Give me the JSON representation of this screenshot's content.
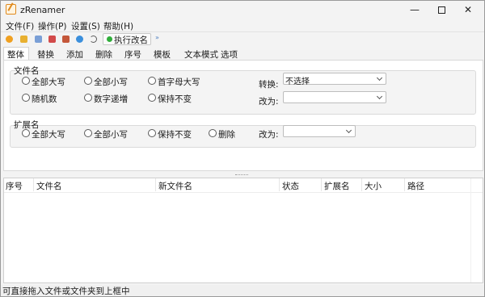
{
  "app": {
    "title": "zRenamer"
  },
  "window_controls": {
    "minimize": "—",
    "close": "✕"
  },
  "menu": [
    {
      "label": "文件(F)"
    },
    {
      "label": "操作(P)"
    },
    {
      "label": "设置(S)"
    },
    {
      "label": "帮助(H)"
    }
  ],
  "toolbar": {
    "icons": [
      {
        "name": "gear-icon",
        "color": "#f0a020"
      },
      {
        "name": "folder-icon",
        "color": "#e8b030"
      },
      {
        "name": "page-icon",
        "color": "#7a9fd6"
      },
      {
        "name": "book-icon",
        "color": "#d24a4a"
      },
      {
        "name": "image-icon",
        "color": "#c4573a"
      },
      {
        "name": "globe-icon",
        "color": "#3b8fdc"
      },
      {
        "name": "undo-icon",
        "color": "#5c5c5c"
      }
    ],
    "execute_label": "执行改名",
    "more_icon": "»"
  },
  "tabs": [
    {
      "label": "整体"
    },
    {
      "label": "替换"
    },
    {
      "label": "添加"
    },
    {
      "label": "删除"
    },
    {
      "label": "序号"
    },
    {
      "label": "模板"
    },
    {
      "label": "文本模式"
    },
    {
      "label": "选项"
    }
  ],
  "filename_group": {
    "label": "文件名",
    "options": [
      {
        "label": "全部大写"
      },
      {
        "label": "全部小写"
      },
      {
        "label": "首字母大写"
      },
      {
        "label": "随机数"
      },
      {
        "label": "数字递増"
      },
      {
        "label": "保持不变"
      }
    ],
    "convert_label": "转换:",
    "convert_value": "不选择",
    "change_to_label": "改为:",
    "change_to_value": ""
  },
  "extension_group": {
    "label": "扩展名",
    "options": [
      {
        "label": "全部大写"
      },
      {
        "label": "全部小写"
      },
      {
        "label": "保持不变"
      },
      {
        "label": "删除"
      }
    ],
    "change_to_label": "改为:",
    "change_to_value": ""
  },
  "table": {
    "columns": [
      {
        "label": "序号"
      },
      {
        "label": "文件名"
      },
      {
        "label": "新文件名"
      },
      {
        "label": "状态"
      },
      {
        "label": "扩展名"
      },
      {
        "label": "大小"
      },
      {
        "label": "路径"
      }
    ],
    "rows": []
  },
  "status": {
    "text": "可直接拖入文件或文件夹到上框中"
  }
}
